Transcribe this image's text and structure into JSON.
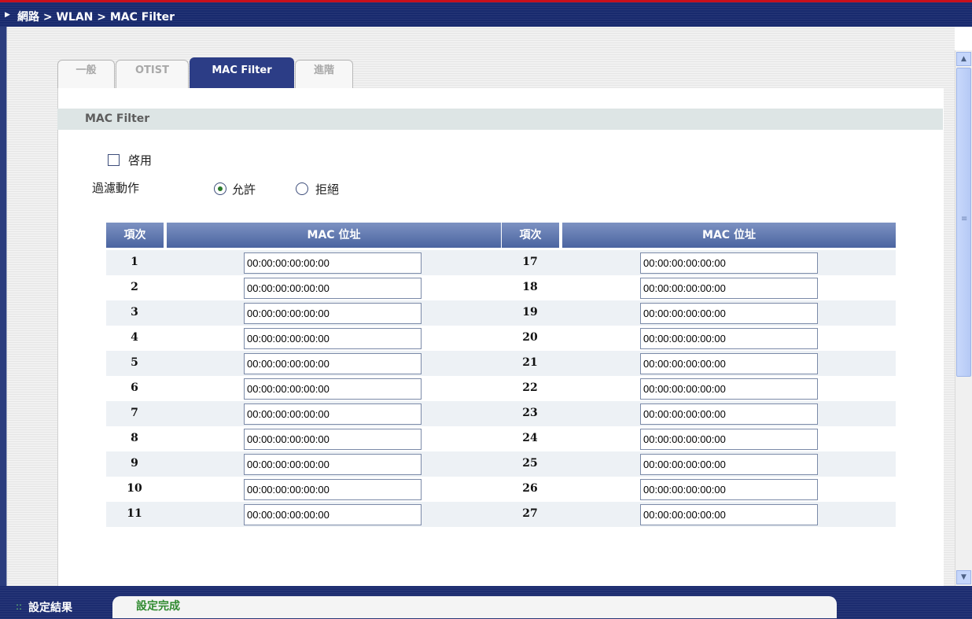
{
  "breadcrumb": "網路 > WLAN > MAC Filter",
  "tabs": [
    {
      "label": "一般",
      "active": false
    },
    {
      "label": "OTIST",
      "active": false
    },
    {
      "label": "MAC Filter",
      "active": true
    },
    {
      "label": "進階",
      "active": false
    }
  ],
  "section_title": "MAC Filter",
  "enable": {
    "label": "啓用",
    "checked": false
  },
  "filter_action": {
    "label": "過濾動作",
    "options": [
      {
        "label": "允許",
        "selected": true
      },
      {
        "label": "拒絕",
        "selected": false
      }
    ]
  },
  "table": {
    "headers": [
      "項次",
      "MAC 位址",
      "項次",
      "MAC 位址"
    ],
    "left_rows": [
      {
        "index": "1",
        "mac": "00:00:00:00:00:00"
      },
      {
        "index": "2",
        "mac": "00:00:00:00:00:00"
      },
      {
        "index": "3",
        "mac": "00:00:00:00:00:00"
      },
      {
        "index": "4",
        "mac": "00:00:00:00:00:00"
      },
      {
        "index": "5",
        "mac": "00:00:00:00:00:00"
      },
      {
        "index": "6",
        "mac": "00:00:00:00:00:00"
      },
      {
        "index": "7",
        "mac": "00:00:00:00:00:00"
      },
      {
        "index": "8",
        "mac": "00:00:00:00:00:00"
      },
      {
        "index": "9",
        "mac": "00:00:00:00:00:00"
      },
      {
        "index": "10",
        "mac": "00:00:00:00:00:00"
      },
      {
        "index": "11",
        "mac": "00:00:00:00:00:00"
      }
    ],
    "right_rows": [
      {
        "index": "17",
        "mac": "00:00:00:00:00:00"
      },
      {
        "index": "18",
        "mac": "00:00:00:00:00:00"
      },
      {
        "index": "19",
        "mac": "00:00:00:00:00:00"
      },
      {
        "index": "20",
        "mac": "00:00:00:00:00:00"
      },
      {
        "index": "21",
        "mac": "00:00:00:00:00:00"
      },
      {
        "index": "22",
        "mac": "00:00:00:00:00:00"
      },
      {
        "index": "23",
        "mac": "00:00:00:00:00:00"
      },
      {
        "index": "24",
        "mac": "00:00:00:00:00:00"
      },
      {
        "index": "25",
        "mac": "00:00:00:00:00:00"
      },
      {
        "index": "26",
        "mac": "00:00:00:00:00:00"
      },
      {
        "index": "27",
        "mac": "00:00:00:00:00:00"
      }
    ]
  },
  "status": {
    "label": "設定結果",
    "message": "設定完成"
  },
  "icons": {
    "breadcrumb_arrow": "triangle-right-icon",
    "scroll_up": "chevron-up-icon",
    "scroll_down": "chevron-down-icon",
    "status_dots": "dots-icon"
  },
  "colors": {
    "header_bar": "#182a6e",
    "accent_red": "#c8101c",
    "active_tab": "#2c3d86",
    "table_header": "#566fa8",
    "status_ok": "#2f8a2f"
  }
}
